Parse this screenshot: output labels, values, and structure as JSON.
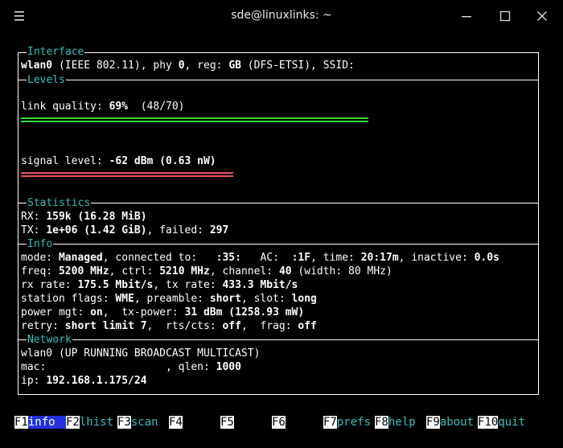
{
  "window": {
    "title": "sde@linuxlinks: ~",
    "icons": [
      "hamburger-menu-icon",
      "minimize-icon",
      "maximize-icon",
      "close-icon"
    ]
  },
  "interface": {
    "label": "Interface",
    "line": {
      "iface": "wlan0",
      "t1": " (IEEE 802.11), phy ",
      "phy": "0",
      "t2": ", reg: ",
      "reg": "GB",
      "t3": " (DFS-ETSI), SSID: "
    }
  },
  "levels": {
    "label": "Levels",
    "link_quality": {
      "prefix": "link quality: ",
      "pct": "69%",
      "rest": "  (48/70)",
      "fraction": 0.69
    },
    "signal": {
      "prefix": "signal level: ",
      "value": "-62 dBm (0.63 nW)"
    }
  },
  "statistics": {
    "label": "Statistics",
    "rx": {
      "prefix": "RX: ",
      "value": "159k (16.28 MiB)"
    },
    "tx": {
      "prefix": "TX: ",
      "value": "1e+06 (1.42 GiB)",
      "mid": ", failed: ",
      "failed": "297"
    }
  },
  "info": {
    "label": "Info",
    "mode": {
      "t1": "mode: ",
      "mode": "Managed",
      "t2": ", connected to:   ",
      "c1": ":35:",
      "t3": "   AC:  ",
      "c2": ":1F",
      "t4": ", time: ",
      "time": "20:17m",
      "t5": ", inactive: ",
      "inactive": "0.0s"
    },
    "freq": {
      "t1": "freq: ",
      "freq": "5200 MHz",
      "t2": ", ctrl: ",
      "ctrl": "5210 MHz",
      "t3": ", channel: ",
      "channel": "40",
      "t4": " (width: 80 MHz)"
    },
    "rate": {
      "t1": "rx rate: ",
      "rx": "175.5 Mbit/s",
      "t2": ", tx rate: ",
      "tx": "433.3 Mbit/s"
    },
    "flags": {
      "t1": "station flags: ",
      "flags": "WME",
      "t2": ", preamble: ",
      "preamble": "short",
      "t3": ", slot: ",
      "slot": "long"
    },
    "power": {
      "t1": "power mgt: ",
      "mgt": "on",
      "t2": ",  tx-power: ",
      "txp": "31 dBm (1258.93 mW)"
    },
    "retry": {
      "t1": "retry: ",
      "limit": "short limit 7",
      "t2": ",  rts/cts: ",
      "rts": "off",
      "t3": ",  frag: ",
      "frag": "off"
    }
  },
  "network": {
    "label": "Network",
    "flags_line": "wlan0 (UP RUNNING BROADCAST MULTICAST)",
    "mac": {
      "t1": "mac: ",
      "t2": "                  , qlen: ",
      "qlen": "1000"
    },
    "ip": {
      "t1": "ip: ",
      "ip": "192.168.1.175/24"
    }
  },
  "fkeys": [
    {
      "num": "F1",
      "label": "info",
      "active": true
    },
    {
      "num": "F2",
      "label": "lhist"
    },
    {
      "num": "F3",
      "label": "scan"
    },
    {
      "num": "F4",
      "label": ""
    },
    {
      "num": "F5",
      "label": ""
    },
    {
      "num": "F6",
      "label": ""
    },
    {
      "num": "F7",
      "label": "prefs"
    },
    {
      "num": "F8",
      "label": "help"
    },
    {
      "num": "F9",
      "label": "about"
    },
    {
      "num": "F10",
      "label": "quit"
    }
  ],
  "colors": {
    "accent": "#33c0c0",
    "good_bar": "#33dd33",
    "bad_bar": "#ee5555",
    "active_key": "#2233dd"
  }
}
